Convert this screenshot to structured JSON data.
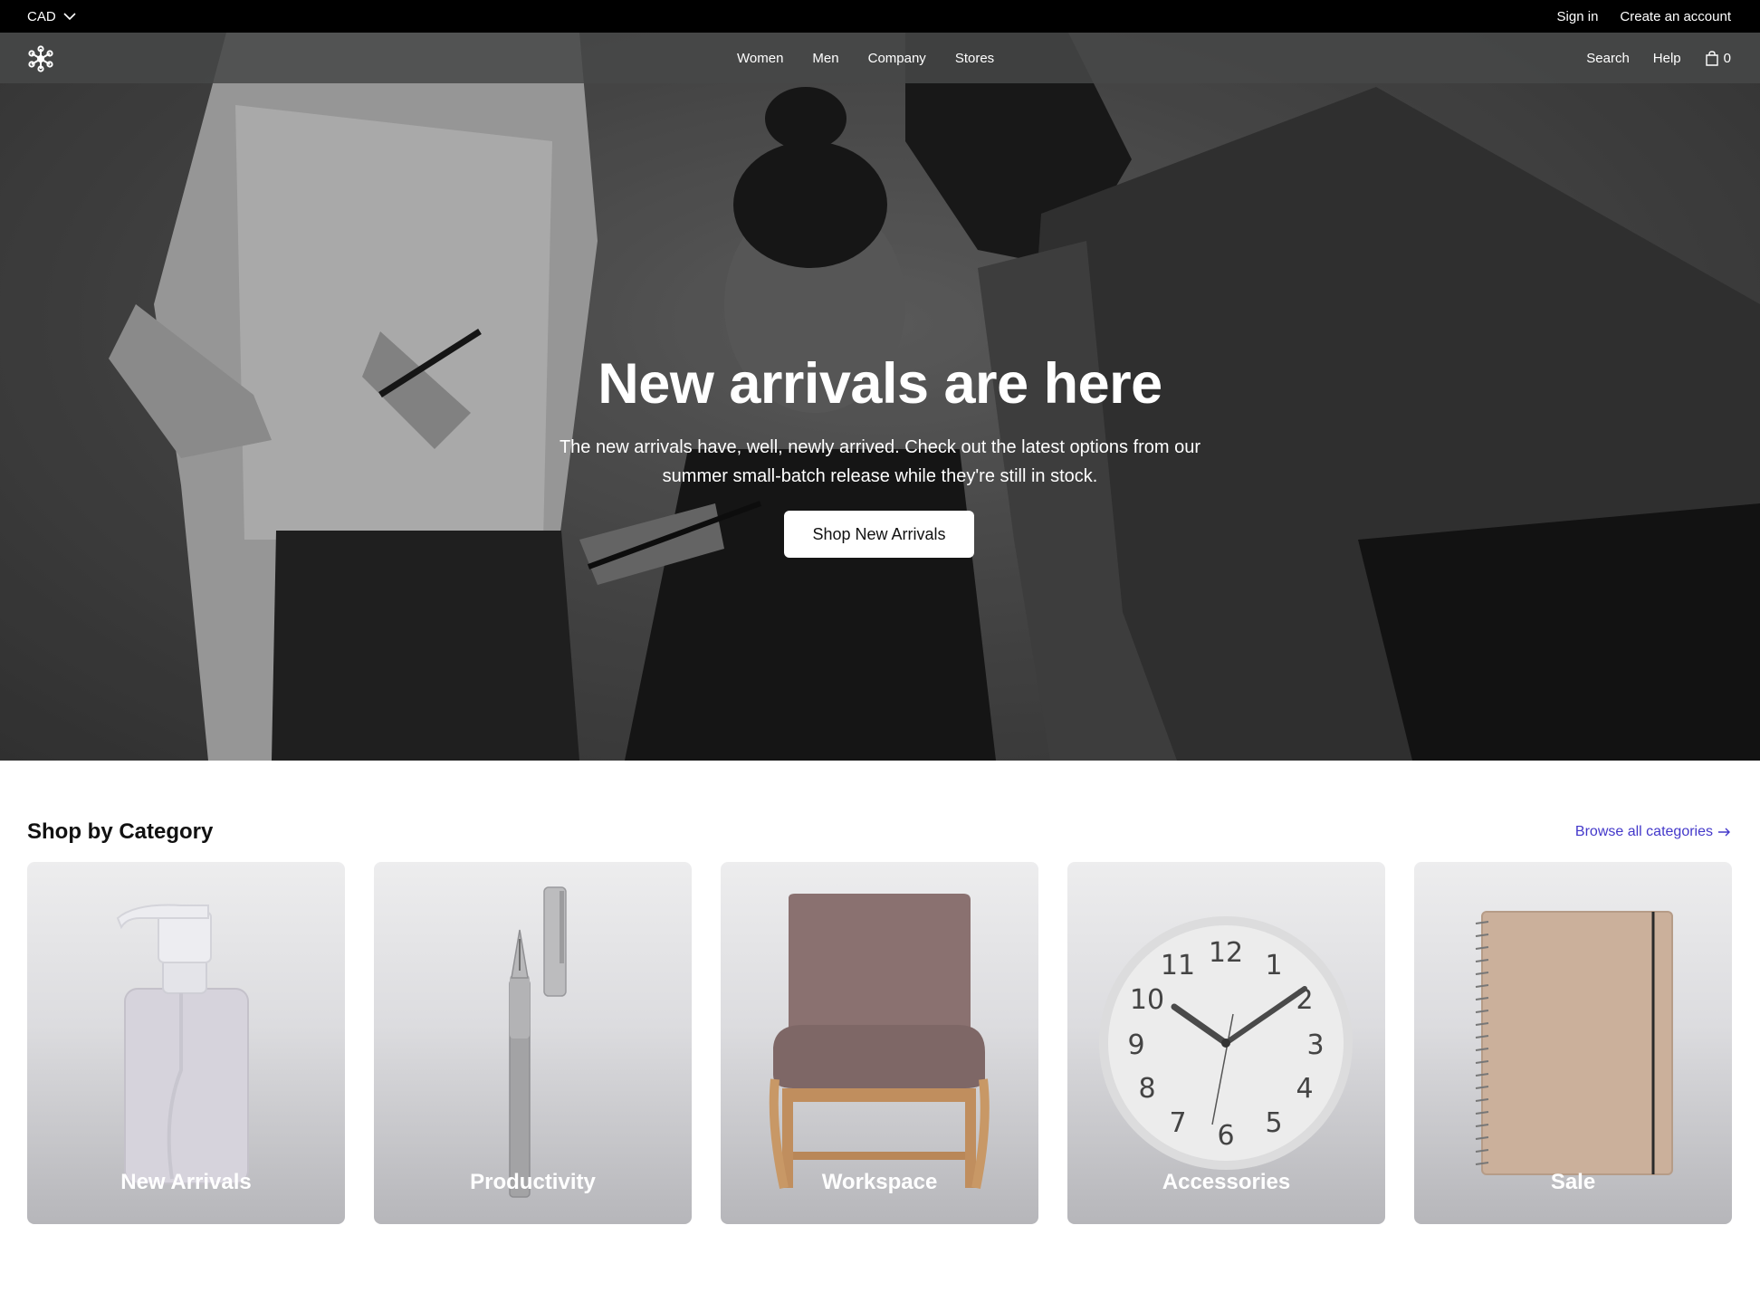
{
  "topbar": {
    "currency": "CAD",
    "sign_in": "Sign in",
    "create_account": "Create an account"
  },
  "nav": {
    "links": [
      "Women",
      "Men",
      "Company",
      "Stores"
    ],
    "search": "Search",
    "help": "Help",
    "cart_count": "0"
  },
  "hero": {
    "title": "New arrivals are here",
    "subtitle": "The new arrivals have, well, newly arrived. Check out the latest options from our summer small-batch release while they're still in stock.",
    "cta": "Shop New Arrivals"
  },
  "categories": {
    "title": "Shop by Category",
    "browse_all": "Browse all categories",
    "items": [
      {
        "label": "New Arrivals",
        "icon": "soap-dispenser"
      },
      {
        "label": "Productivity",
        "icon": "pen"
      },
      {
        "label": "Workspace",
        "icon": "chair"
      },
      {
        "label": "Accessories",
        "icon": "clock"
      },
      {
        "label": "Sale",
        "icon": "notebook"
      }
    ]
  },
  "colors": {
    "accent": "#4338ca",
    "topbar": "#000000",
    "nav": "#464848"
  }
}
